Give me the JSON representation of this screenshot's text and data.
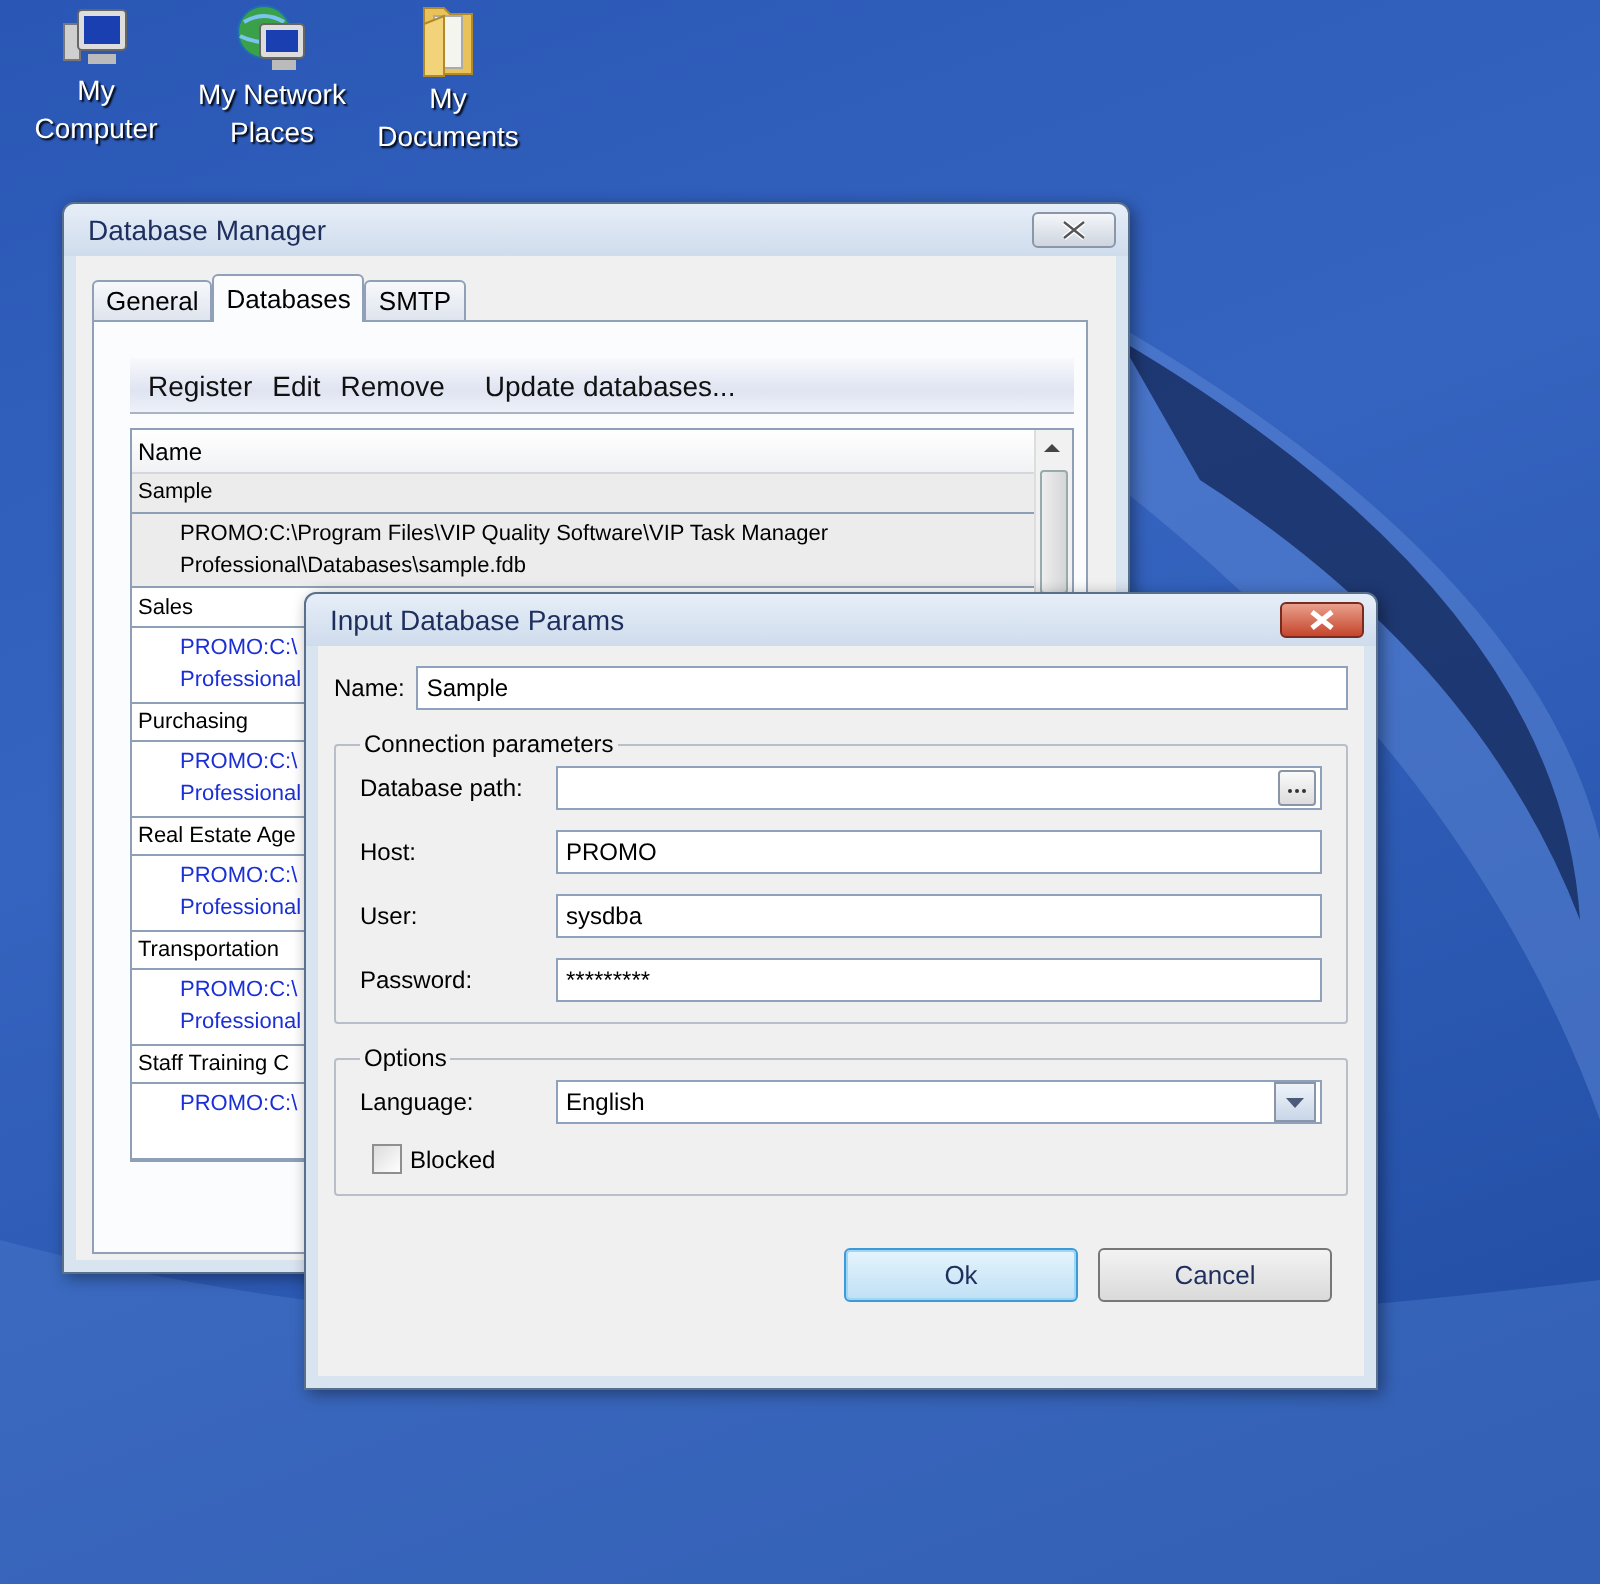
{
  "desktop_icons": [
    {
      "kind": "computer",
      "label_lines": [
        "My",
        "Computer"
      ]
    },
    {
      "kind": "network",
      "label_lines": [
        "My Network",
        "Places"
      ]
    },
    {
      "kind": "folder",
      "label_lines": [
        "My",
        "Documents"
      ]
    }
  ],
  "manager": {
    "title": "Database Manager",
    "tabs": [
      {
        "label": "General",
        "selected": false
      },
      {
        "label": "Databases",
        "selected": true
      },
      {
        "label": "SMTP",
        "selected": false
      }
    ],
    "toolbar": [
      "Register",
      "Edit",
      "Remove",
      "Update databases..."
    ],
    "table": {
      "columns": [
        "Name"
      ],
      "rows": [
        {
          "name": "Sample",
          "selected": true,
          "path_lines": [
            "PROMO:C:\\Program Files\\VIP Quality Software\\VIP Task Manager",
            "Professional\\Databases\\sample.fdb"
          ]
        },
        {
          "name": "Sales",
          "selected": false,
          "path_lines": [
            "PROMO:C:\\",
            "Professional"
          ]
        },
        {
          "name": "Purchasing",
          "selected": false,
          "path_lines": [
            "PROMO:C:\\",
            "Professional"
          ]
        },
        {
          "name": "Real Estate Age",
          "selected": false,
          "path_lines": [
            "PROMO:C:\\",
            "Professional"
          ]
        },
        {
          "name": "Transportation",
          "selected": false,
          "path_lines": [
            "PROMO:C:\\",
            "Professional"
          ]
        },
        {
          "name": "Staff Training C",
          "selected": false,
          "path_lines": [
            "PROMO:C:\\"
          ]
        }
      ]
    }
  },
  "dialog": {
    "title": "Input Database Params",
    "name": {
      "label": "Name:",
      "value": "Sample"
    },
    "connection": {
      "legend": "Connection parameters",
      "fields": [
        {
          "kind": "browse",
          "label": "Database path:"
        },
        {
          "kind": "text",
          "label": "Host:",
          "value": "PROMO"
        },
        {
          "kind": "text",
          "label": "User:",
          "value": "sysdba"
        },
        {
          "kind": "text",
          "label": "Password:",
          "value": "*********"
        }
      ]
    },
    "options": {
      "legend": "Options",
      "language": {
        "label": "Language:",
        "value": "English"
      },
      "blocked": {
        "label": "Blocked",
        "checked": false
      }
    },
    "buttons": [
      {
        "label": "Ok",
        "selected": true
      },
      {
        "label": "Cancel",
        "selected": false
      }
    ]
  }
}
